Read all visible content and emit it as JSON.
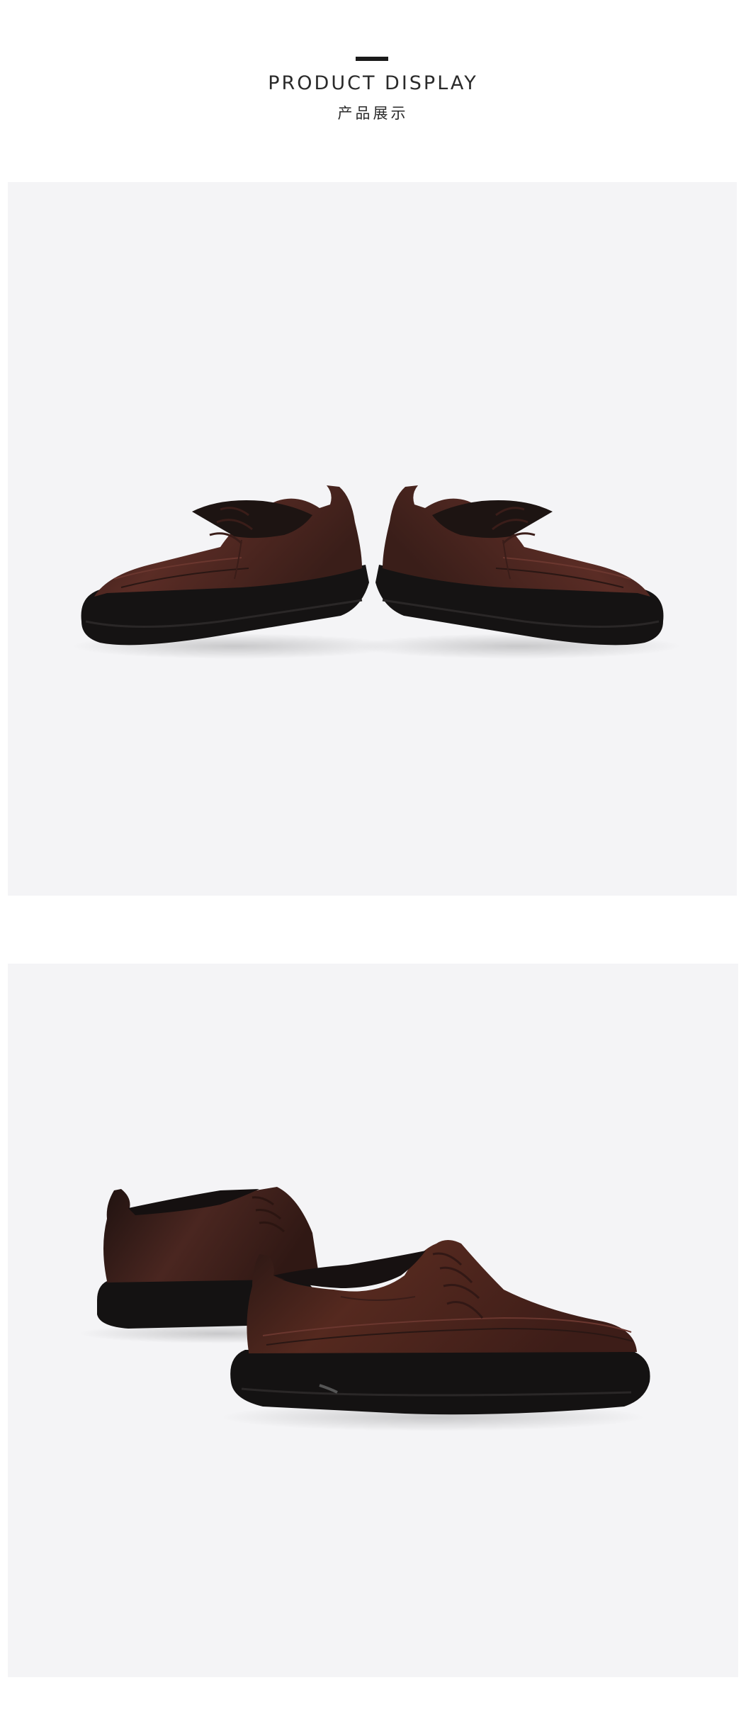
{
  "header": {
    "title_en": "PRODUCT DISPLAY",
    "title_zh": "产品展示"
  },
  "colors": {
    "panel_background": "#f4f4f6",
    "leather_brown": "#4a2620",
    "sole_black": "#141212"
  },
  "photos": [
    {
      "name": "shoe-pair-front-view"
    },
    {
      "name": "shoe-pair-side-view"
    }
  ]
}
